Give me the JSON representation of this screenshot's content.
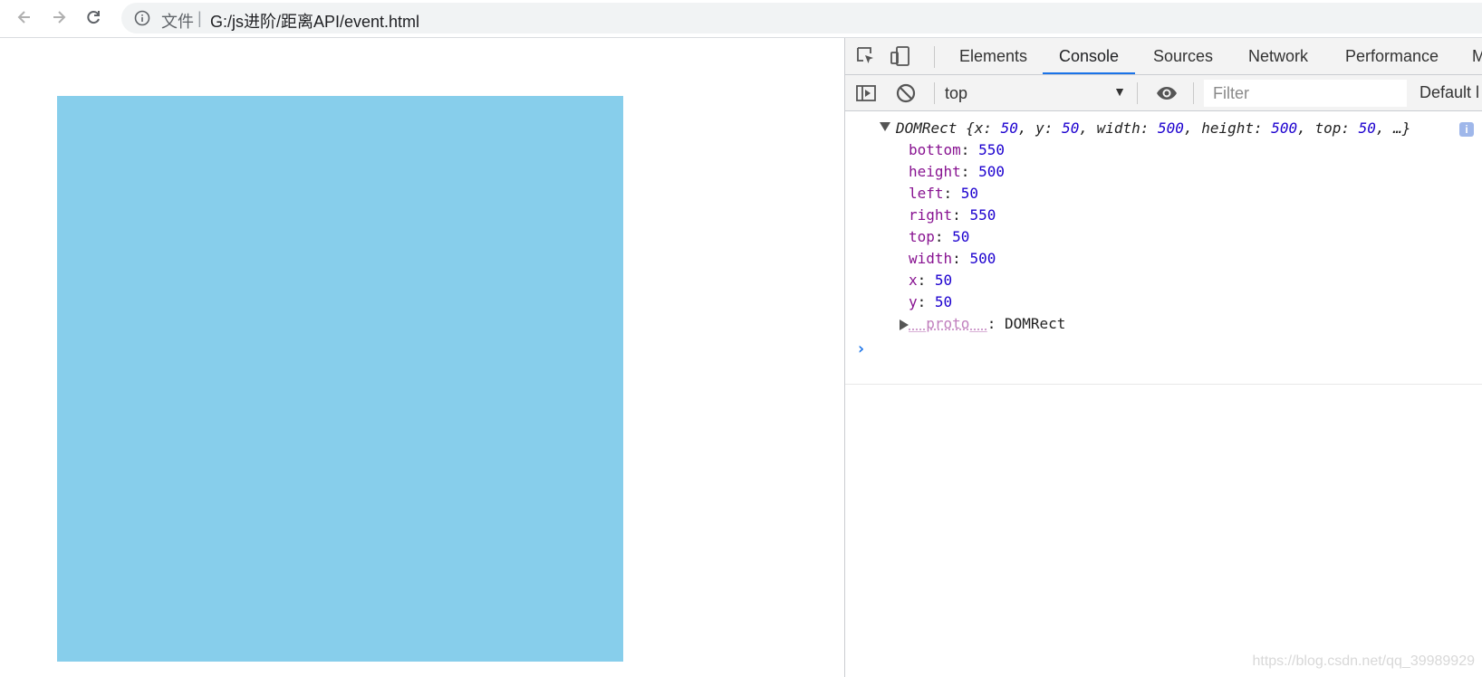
{
  "browser": {
    "address": {
      "label": "文件",
      "separator": "|",
      "url": "G:/js进阶/距离API/event.html"
    }
  },
  "page": {
    "box_color": "#87ceeb"
  },
  "devtools": {
    "tabs": [
      {
        "label": "Elements",
        "active": false
      },
      {
        "label": "Console",
        "active": true
      },
      {
        "label": "Sources",
        "active": false
      },
      {
        "label": "Network",
        "active": false
      },
      {
        "label": "Performance",
        "active": false
      },
      {
        "label": "M",
        "active": false
      }
    ],
    "context": "top",
    "filter_placeholder": "Filter",
    "levels_label": "Default l",
    "console": {
      "summary": {
        "name": "DOMRect",
        "open": "{",
        "pairs": [
          {
            "key": "x",
            "value": "50"
          },
          {
            "key": "y",
            "value": "50"
          },
          {
            "key": "width",
            "value": "500"
          },
          {
            "key": "height",
            "value": "500"
          },
          {
            "key": "top",
            "value": "50"
          }
        ],
        "ellipsis": "…}"
      },
      "properties": [
        {
          "key": "bottom",
          "value": "550"
        },
        {
          "key": "height",
          "value": "500"
        },
        {
          "key": "left",
          "value": "50"
        },
        {
          "key": "right",
          "value": "550"
        },
        {
          "key": "top",
          "value": "50"
        },
        {
          "key": "width",
          "value": "500"
        },
        {
          "key": "x",
          "value": "50"
        },
        {
          "key": "y",
          "value": "50"
        }
      ],
      "proto_key": "__proto__",
      "proto_value": "DOMRect",
      "prompt_symbol": "›"
    }
  },
  "watermark": "https://blog.csdn.net/qq_39989929"
}
